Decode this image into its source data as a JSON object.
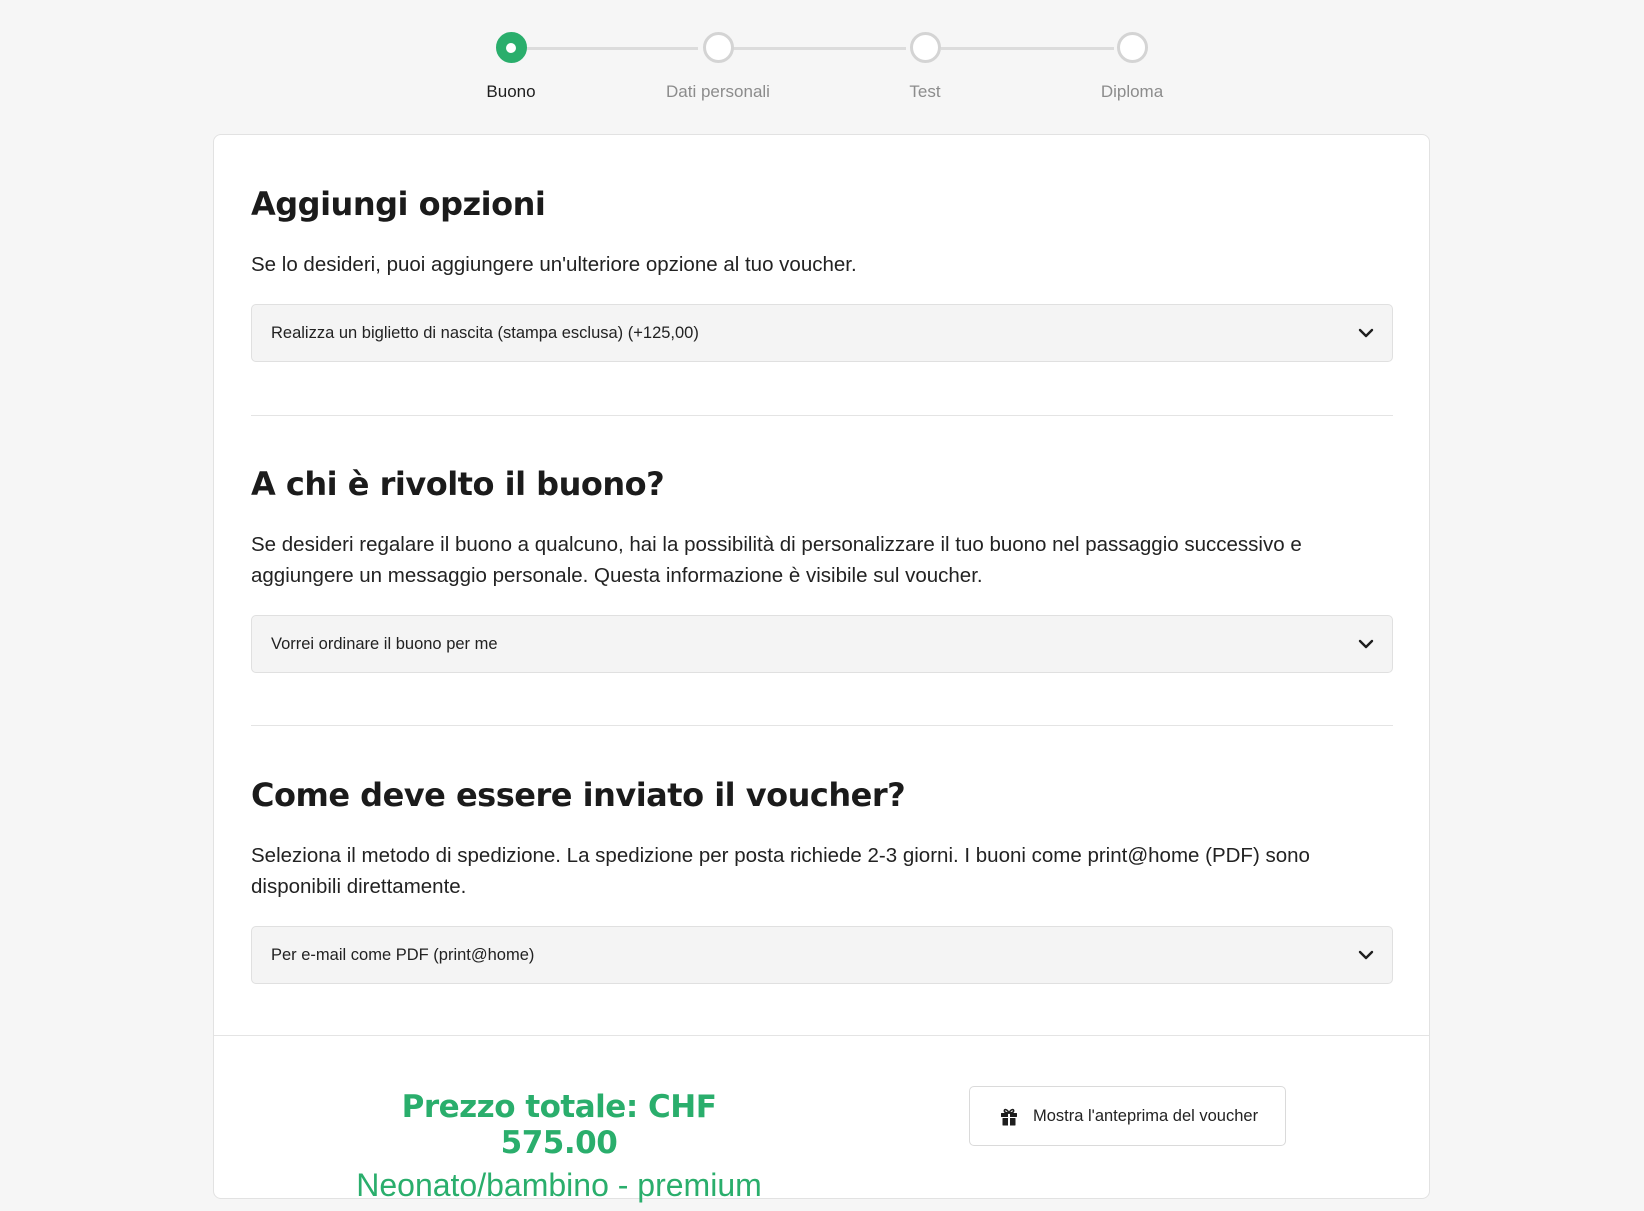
{
  "stepper": {
    "steps": [
      {
        "label": "Buono",
        "state": "active"
      },
      {
        "label": "Dati personali",
        "state": "pending"
      },
      {
        "label": "Test",
        "state": "pending"
      },
      {
        "label": "Diploma",
        "state": "pending"
      }
    ],
    "active_color": "#2aae6c"
  },
  "options": {
    "heading": "Aggiungi opzioni",
    "description": "Se lo desideri, puoi aggiungere un'ulteriore opzione al tuo voucher.",
    "selected": "Realizza un biglietto di nascita (stampa esclusa) (+125,00)"
  },
  "recipient": {
    "heading": "A chi è rivolto il buono?",
    "description": "Se desideri regalare il buono a qualcuno, hai la possibilità di personalizzare il tuo buono nel passaggio successivo e aggiungere un messaggio personale. Questa informazione è visibile sul voucher.",
    "selected": "Vorrei ordinare il buono per me"
  },
  "delivery": {
    "heading": "Come deve essere inviato il voucher?",
    "description": "Seleziona il metodo di spedizione. La spedizione per posta richiede 2-3 giorni. I buoni come print@home (PDF) sono disponibili direttamente.",
    "selected": "Per e-mail come PDF (print@home)"
  },
  "summary": {
    "total_label": "Prezzo totale: CHF 575.00",
    "product": "Neonato/bambino - premium",
    "preview_button": "Mostra l'anteprima del voucher",
    "preview_icon": "gift-icon",
    "price_color": "#2aae6c"
  }
}
